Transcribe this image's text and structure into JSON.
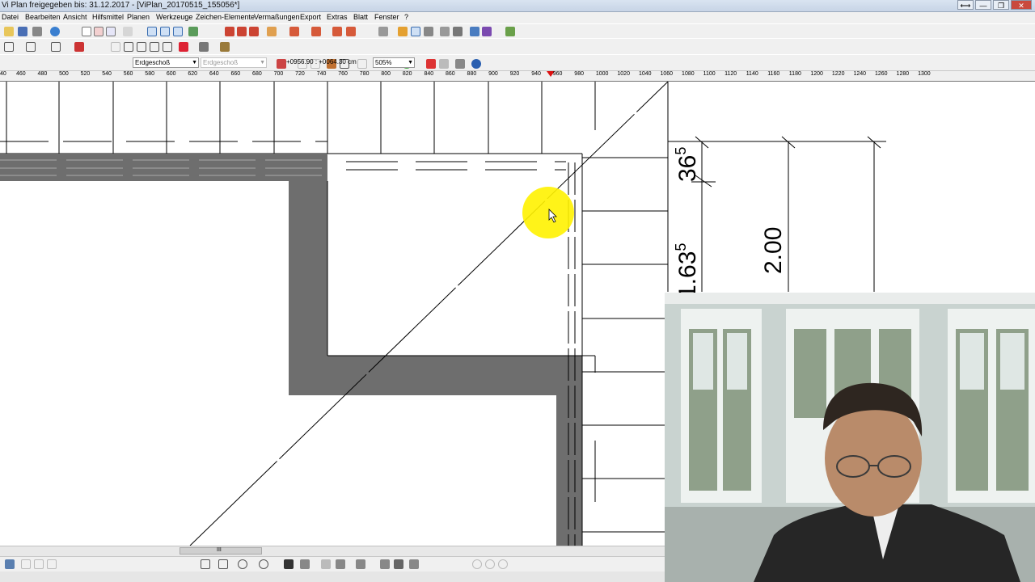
{
  "window": {
    "title": "Vi Plan freigegeben bis: 31.12.2017 - [ViPlan_20170515_155056*]",
    "buttons": [
      "⟷",
      "—",
      "❐",
      "✕"
    ]
  },
  "menu": [
    "Datei",
    "Bearbeiten",
    "Ansicht",
    "Hilfsmittel",
    "Planen",
    "Werkzeuge",
    "Zeichen-Elemente",
    "Vermaßungen",
    "Export",
    "Extras",
    "Blatt",
    "Fenster",
    "?"
  ],
  "toolbar3": {
    "floor_select": "Erdgeschoß",
    "floor_select_2": "Erdgeschoß",
    "coordinates": "+0956.90 : +0064.30 cm",
    "zoom": "505%"
  },
  "ruler": {
    "labels": [
      "40",
      "460",
      "480",
      "500",
      "520",
      "540",
      "560",
      "580",
      "600",
      "620",
      "640",
      "660",
      "680",
      "700",
      "720",
      "740",
      "760",
      "780",
      "800",
      "820",
      "840",
      "860",
      "880",
      "900",
      "920",
      "940",
      "960",
      "980",
      "1000",
      "1020",
      "1040",
      "1060",
      "1080",
      "1100",
      "1120",
      "1140",
      "1160",
      "1180",
      "1200",
      "1220",
      "1240",
      "1260",
      "1280",
      "1300"
    ]
  },
  "dimensions": {
    "dim_365": "36",
    "dim_365_sup": "5",
    "dim_1635": "1.63",
    "dim_1635_sup": "5",
    "dim_200": "2.00"
  },
  "colors": {
    "wall": "#6e6e6e",
    "cursor_highlight": "#fff200",
    "ruler_marker": "#dd1111"
  },
  "scrollbar": {
    "grip": "III"
  }
}
